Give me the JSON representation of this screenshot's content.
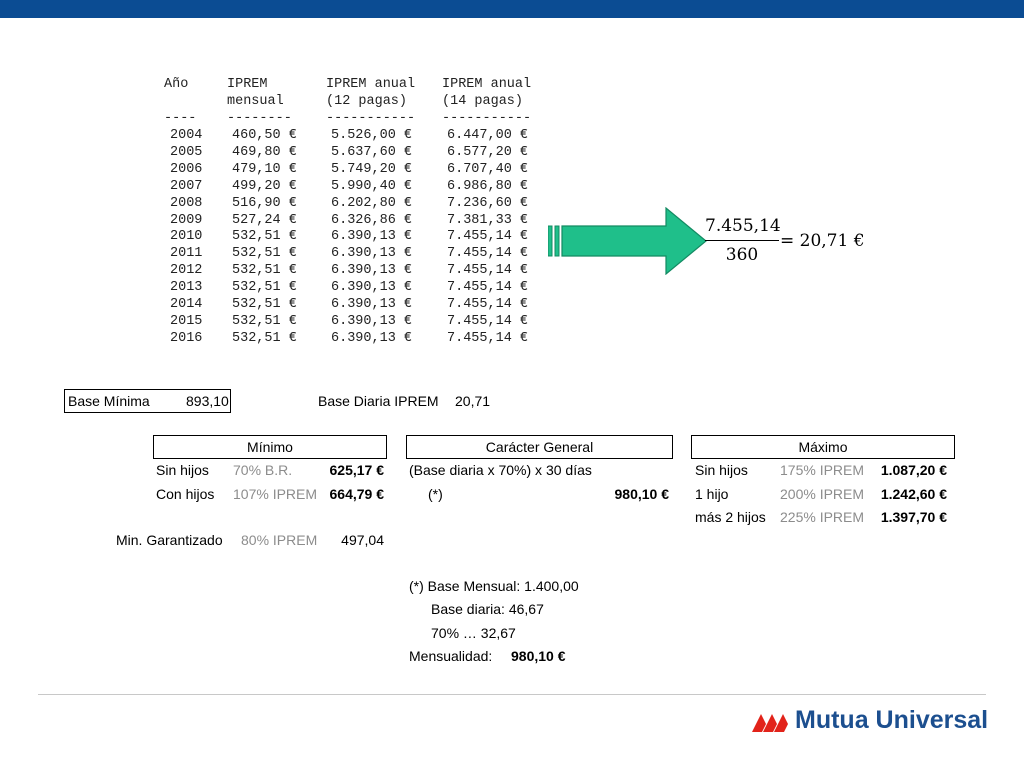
{
  "iprem_table": {
    "headers": {
      "year": "Año",
      "monthly_l1": "IPREM",
      "monthly_l2": "mensual",
      "annual12_l1": "IPREM anual",
      "annual12_l2": "(12 pagas)",
      "annual14_l1": "IPREM anual",
      "annual14_l2": "(14 pagas)"
    },
    "separators": [
      "----",
      "--------",
      "-----------",
      "-----------"
    ],
    "rows": [
      {
        "year": "2004",
        "monthly": "460,50 €",
        "annual12": "5.526,00 €",
        "annual14": "6.447,00 €"
      },
      {
        "year": "2005",
        "monthly": "469,80 €",
        "annual12": "5.637,60 €",
        "annual14": "6.577,20 €"
      },
      {
        "year": "2006",
        "monthly": "479,10 €",
        "annual12": "5.749,20 €",
        "annual14": "6.707,40 €"
      },
      {
        "year": "2007",
        "monthly": "499,20 €",
        "annual12": "5.990,40 €",
        "annual14": "6.986,80 €"
      },
      {
        "year": "2008",
        "monthly": "516,90 €",
        "annual12": "6.202,80 €",
        "annual14": "7.236,60 €"
      },
      {
        "year": "2009",
        "monthly": "527,24 €",
        "annual12": "6.326,86 €",
        "annual14": "7.381,33 €"
      },
      {
        "year": "2010",
        "monthly": "532,51 €",
        "annual12": "6.390,13 €",
        "annual14": "7.455,14 €"
      },
      {
        "year": "2011",
        "monthly": "532,51 €",
        "annual12": "6.390,13 €",
        "annual14": "7.455,14 €"
      },
      {
        "year": "2012",
        "monthly": "532,51 €",
        "annual12": "6.390,13 €",
        "annual14": "7.455,14 €"
      },
      {
        "year": "2013",
        "monthly": "532,51 €",
        "annual12": "6.390,13 €",
        "annual14": "7.455,14 €"
      },
      {
        "year": "2014",
        "monthly": "532,51 €",
        "annual12": "6.390,13 €",
        "annual14": "7.455,14 €"
      },
      {
        "year": "2015",
        "monthly": "532,51 €",
        "annual12": "6.390,13 €",
        "annual14": "7.455,14 €"
      },
      {
        "year": "2016",
        "monthly": "532,51 €",
        "annual12": "6.390,13 €",
        "annual14": "7.455,14 €"
      }
    ]
  },
  "formula": {
    "numerator": "7.455,14",
    "denominator": "360",
    "result": "= 20,71 €"
  },
  "bases": {
    "minima_label": "Base Mínima",
    "minima_value": "893,10",
    "diaria_label": "Base Diaria IPREM",
    "diaria_value": "20,71"
  },
  "minimo": {
    "title": "Mínimo",
    "rows": [
      {
        "label": "Sin hijos",
        "pct": "70% B.R.",
        "value": "625,17 €"
      },
      {
        "label": "Con hijos",
        "pct": "107% IPREM",
        "value": "664,79 €"
      }
    ],
    "garantizado": {
      "label": "Min. Garantizado",
      "pct": "80% IPREM",
      "value": "497,04"
    }
  },
  "general": {
    "title": "Carácter General",
    "line1": "(Base diaria x 70%) x 30 días",
    "note": "(*)",
    "value": "980,10 €"
  },
  "maximo": {
    "title": "Máximo",
    "rows": [
      {
        "label": "Sin hijos",
        "pct": "175% IPREM",
        "value": "1.087,20 €"
      },
      {
        "label": "1 hijo",
        "pct": "200% IPREM",
        "value": "1.242,60 €"
      },
      {
        "label": "más 2 hijos",
        "pct": "225% IPREM",
        "value": "1.397,70 €"
      }
    ]
  },
  "footnote": {
    "line1": "(*) Base Mensual: 1.400,00",
    "line2": "Base diaria:  46,67",
    "line3": "70% … 32,67",
    "line4_label": "Mensualidad:",
    "line4_value": "980,10 €"
  },
  "brand": {
    "name": "Mutua Universal",
    "topbar_color": "#0b4c93",
    "arrow_color": "#1fbf8a",
    "logo_red": "#e2231a",
    "logo_blue": "#1c4f8f"
  }
}
